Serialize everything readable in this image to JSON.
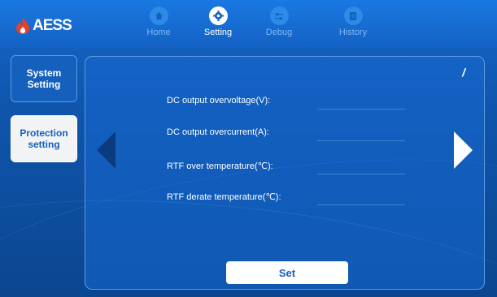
{
  "brand": {
    "name": "AESS",
    "logo_color": "#e8402a"
  },
  "nav": {
    "items": [
      {
        "label": "Home",
        "icon": "home-icon",
        "active": false
      },
      {
        "label": "Setting",
        "icon": "gear-icon",
        "active": true
      },
      {
        "label": "Debug",
        "icon": "sliders-icon",
        "active": false
      },
      {
        "label": "History",
        "icon": "document-icon",
        "active": false
      }
    ]
  },
  "sidebar": {
    "items": [
      {
        "label_line1": "System",
        "label_line2": "Setting",
        "active": false
      },
      {
        "label_line1": "Protection",
        "label_line2": "setting",
        "active": true
      }
    ]
  },
  "panel": {
    "page_indicator": "/",
    "fields": [
      {
        "label": "DC output overvoltage(V):",
        "value": ""
      },
      {
        "label": "DC output overcurrent(A):",
        "value": ""
      },
      {
        "label": "RTF over temperature(℃):",
        "value": ""
      },
      {
        "label": "RTF derate temperature(℃):",
        "value": ""
      }
    ],
    "set_label": "Set"
  },
  "colors": {
    "background": "#1567c9",
    "accent": "#1560bd",
    "active_tab": "#ffffff"
  }
}
